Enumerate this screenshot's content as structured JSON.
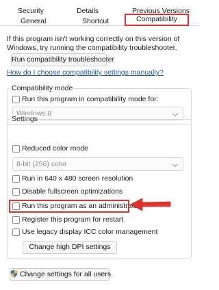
{
  "tabs": {
    "row1": [
      "Security",
      "Details",
      "Previous Versions"
    ],
    "row2": [
      "General",
      "Shortcut"
    ],
    "active": "Compatibility"
  },
  "intro_text": "If this program isn't working correctly on this version of Windows, try running the compatibility troubleshooter.",
  "troubleshooter_button": "Run compatibility troubleshooter",
  "help_link": "How do I choose compatibility settings manually?",
  "compat_mode": {
    "title": "Compatibility mode",
    "checkbox_label": "Run this program in compatibility mode for:",
    "select_value": "Windows 8"
  },
  "settings": {
    "title": "Settings",
    "reduced_color": "Reduced color mode",
    "color_select_value": "8-bit (256) color",
    "run_640": "Run in 640 x 480 screen resolution",
    "disable_fullscreen": "Disable fullscreen optimizations",
    "run_admin": "Run this program as an administrator",
    "register_restart": "Register this program for restart",
    "legacy_icc": "Use legacy display ICC color management",
    "dpi_button": "Change high DPI settings"
  },
  "all_users_button": "Change settings for all users",
  "colors": {
    "highlight_red": "#e4312b",
    "link_blue": "#1a58b8"
  },
  "icons": {
    "chevron": "chevron-down-icon",
    "shield": "shield-icon",
    "arrow": "red-arrow-icon"
  }
}
